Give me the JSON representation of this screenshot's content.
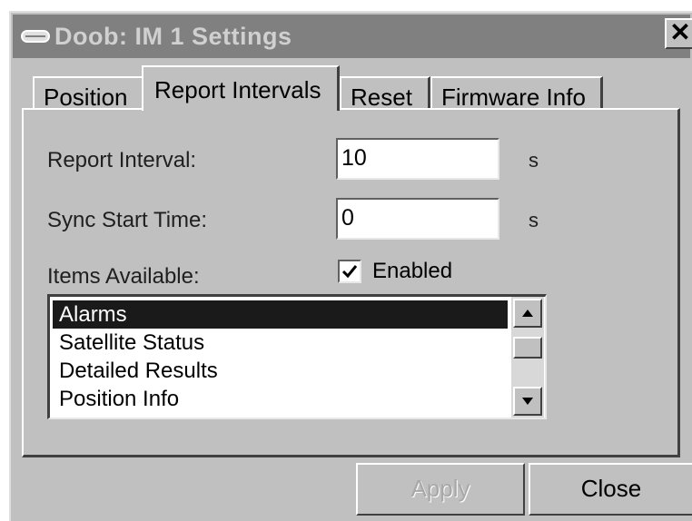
{
  "window": {
    "title": "Doob: IM 1 Settings",
    "close_glyph": "✕"
  },
  "tabs": [
    {
      "label": "Position",
      "active": false
    },
    {
      "label": "Report Intervals",
      "active": true
    },
    {
      "label": "Reset",
      "active": false
    },
    {
      "label": "Firmware Info",
      "active": false
    }
  ],
  "form": {
    "report_interval_label": "Report Interval:",
    "report_interval_value": "10",
    "report_interval_unit": "s",
    "sync_start_label": "Sync Start Time:",
    "sync_start_value": "0",
    "sync_start_unit": "s",
    "items_available_label": "Items Available:",
    "enabled_label": "Enabled",
    "enabled_checked": true
  },
  "list": {
    "items": [
      "Alarms",
      "Satellite Status",
      "Detailed Results",
      "Position Info"
    ],
    "selected_index": 0
  },
  "buttons": {
    "apply_label": "Apply",
    "apply_disabled": true,
    "close_label": "Close"
  },
  "icons": {
    "title_icon": "device-icon",
    "checkmark": "checkmark-icon",
    "scroll_up": "arrow-up-icon",
    "scroll_down": "arrow-down-icon"
  }
}
